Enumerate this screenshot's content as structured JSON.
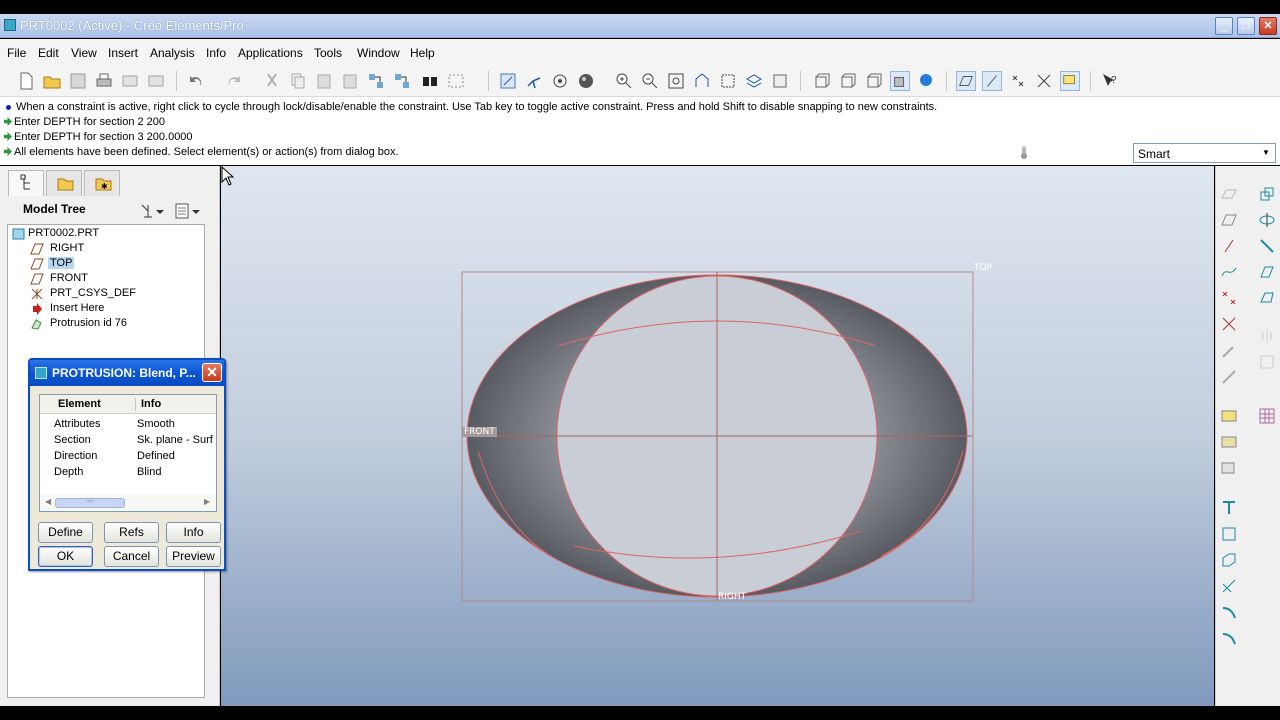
{
  "window": {
    "title": "PRT0002 (Active) - Creo Elements/Pro"
  },
  "menu": [
    "File",
    "Edit",
    "View",
    "Insert",
    "Analysis",
    "Info",
    "Applications",
    "Tools",
    "Window",
    "Help"
  ],
  "messages": [
    "When a constraint is active, right click to cycle through lock/disable/enable the constraint. Use Tab key to toggle active constraint. Press and hold Shift to disable snapping to new constraints.",
    "Enter DEPTH for section 2  200",
    "Enter DEPTH for section 3  200.0000",
    "All elements have been defined. Select element(s) or action(s) from dialog box."
  ],
  "filter": {
    "value": "Smart"
  },
  "model_tree": {
    "title": "Model Tree",
    "nodes": [
      "PRT0002.PRT",
      "RIGHT",
      "TOP",
      "FRONT",
      "PRT_CSYS_DEF",
      "Insert Here",
      "Protrusion id 76"
    ]
  },
  "viewport": {
    "labels": {
      "top": "TOP",
      "front": "FRONT",
      "right": "RIGHT"
    }
  },
  "dialog": {
    "title": "PROTRUSION: Blend, P...",
    "columns": [
      "Element",
      "Info"
    ],
    "rows": [
      {
        "element": "Attributes",
        "info": "Smooth"
      },
      {
        "element": "Section",
        "info": "Sk. plane - Surf"
      },
      {
        "element": "Direction",
        "info": "Defined"
      },
      {
        "element": "Depth",
        "info": "Blind"
      }
    ],
    "buttons": {
      "define": "Define",
      "refs": "Refs",
      "info": "Info",
      "ok": "OK",
      "cancel": "Cancel",
      "preview": "Preview"
    }
  },
  "colors": {
    "titlebar": "#aac2ea",
    "dialog_title": "#0b55d4",
    "datum": "#e06060",
    "selection": "#b5d7f4"
  }
}
